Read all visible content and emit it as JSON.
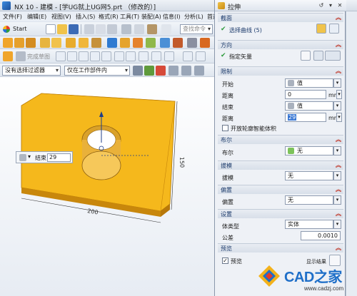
{
  "app": {
    "title": "NX 10 - 建模 - [学UG就上UG网5.prt （修改的）]",
    "menu": [
      "文件(F)",
      "编辑(E)",
      "视图(V)",
      "插入(S)",
      "格式(R)",
      "工具(T)",
      "装配(A)",
      "信息(I)",
      "分析(L)",
      "首选"
    ],
    "start_label": "Start",
    "filter_selection": "没有选择过滤器",
    "scope_selection": "仅在工作部件内",
    "search_placeholder": "查找命令",
    "finish_sketch": "完成草图"
  },
  "viewport": {
    "mini_bar": {
      "label": "结束",
      "value": "29"
    },
    "dim_width": "200",
    "dim_height": "150"
  },
  "dialog": {
    "title": "拉伸",
    "sections": {
      "section_curve": {
        "header": "截面",
        "select_label": "选择曲线 (5)"
      },
      "direction": {
        "header": "方向",
        "vector_label": "指定矢量"
      },
      "limits": {
        "header": "限制",
        "start_label": "开始",
        "start_mode": "值",
        "start_distance_label": "距离",
        "start_distance": "0",
        "end_label": "结束",
        "end_mode": "值",
        "end_distance_label": "距离",
        "end_distance": "29",
        "unit": "mm",
        "open_profile_label": "开放轮廓智能体积"
      },
      "boolean": {
        "header": "布尔",
        "label": "布尔",
        "value": "无"
      },
      "draft": {
        "header": "拔模",
        "label": "拔模",
        "value": "无"
      },
      "offset": {
        "header": "偏置",
        "label": "偏置",
        "value": "无"
      },
      "settings": {
        "header": "设置",
        "body_type_label": "体类型",
        "body_type_value": "实体",
        "tolerance_label": "公差",
        "tolerance_value": "0.0010"
      },
      "preview": {
        "header": "预览",
        "preview_label": "预览",
        "show_result_label": "显示结果"
      }
    }
  },
  "watermark": {
    "brand": "CAD之家",
    "url": "www.cadzj.com"
  },
  "colors": {
    "block_face": "#f5b81c",
    "block_side": "#d99a10",
    "accent_blue": "#1f6fc8"
  }
}
